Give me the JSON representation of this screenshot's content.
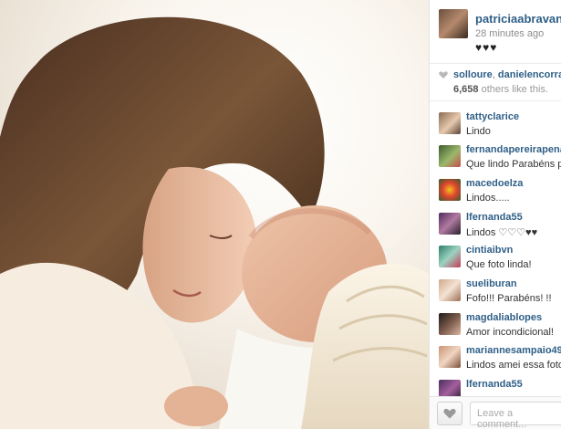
{
  "post": {
    "owner": "patriciaabravanel",
    "time": "28 minutes ago",
    "caption": "♥♥♥"
  },
  "likes": {
    "liker1": "solloure",
    "liker2": "danielencorradi",
    "count_number": "6,658",
    "count_suffix": "others like this."
  },
  "comments": [
    {
      "user": "tattyclarice",
      "text": "Lindo"
    },
    {
      "user": "fernandapereirapenaranda",
      "text": "Que lindo Parabéns pa"
    },
    {
      "user": "macedoelza",
      "text": "Lindos....."
    },
    {
      "user": "lfernanda55",
      "text": "Lindos ♡♡♡♥♥"
    },
    {
      "user": "cintiaibvn",
      "text": "Que foto linda!"
    },
    {
      "user": "sueliburan",
      "text": "Fofo!!! Parabéns! !!"
    },
    {
      "user": "magdaliablopes",
      "text": "Amor incondicional!"
    },
    {
      "user": "mariannesampaio49",
      "text": "Lindos amei essa foto."
    },
    {
      "user": "lfernanda55",
      "text": ""
    }
  ],
  "footer": {
    "comment_placeholder": "Leave a comment..."
  },
  "icons": {
    "like": "heart-icon",
    "like_button": "heart-icon"
  },
  "colors": {
    "username": "#2f5f87",
    "meta": "#8c8c8c"
  }
}
